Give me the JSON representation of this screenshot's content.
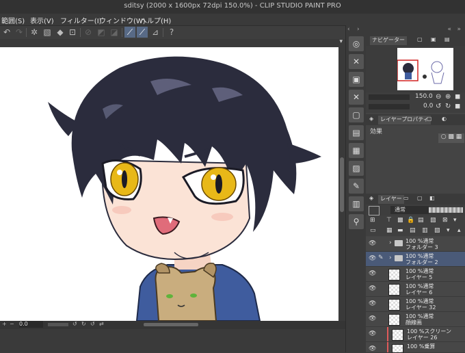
{
  "window": {
    "title": "sditsy (2000 x 1600px 72dpi 150.0%)  - CLIP STUDIO PAINT PRO"
  },
  "menu": [
    {
      "label": "範囲(S)",
      "name": "menu-selection"
    },
    {
      "label": "表示(V)",
      "name": "menu-view"
    },
    {
      "label": "フィルター(I)",
      "name": "menu-filter"
    },
    {
      "label": "ウィンドウ(W)",
      "name": "menu-window"
    },
    {
      "label": "ヘルプ(H)",
      "name": "menu-help"
    }
  ],
  "toolbar": {
    "icons": [
      "undo-icon",
      "redo-icon",
      "spinner-icon",
      "fill-icon",
      "bucket-icon",
      "transform-icon",
      "clear-icon",
      "fill-area-icon",
      "fill-outside-icon",
      "snap-ruler-icon",
      "snap-special-ruler-icon",
      "snap-grid-icon",
      "help-icon"
    ]
  },
  "navigator": {
    "tab_label": "ナビゲーター",
    "zoom": "150.0",
    "rotation": "0.0"
  },
  "layer_property": {
    "tab_label": "レイヤープロパティ",
    "effect_label": "効果"
  },
  "layers_panel": {
    "tab_label": "レイヤー",
    "blend_mode": "通常",
    "layers": [
      {
        "name": "フォルダー 3",
        "info": "100 %通常",
        "type": "folder",
        "selected": false,
        "tag": ""
      },
      {
        "name": "フォルダー 2",
        "info": "100 %通常",
        "type": "folder",
        "selected": true,
        "tag": ""
      },
      {
        "name": "レイヤー 5",
        "info": "100 %通常",
        "type": "layer",
        "selected": false,
        "tag": ""
      },
      {
        "name": "レイヤー 6",
        "info": "100 %通常",
        "type": "layer",
        "selected": false,
        "tag": ""
      },
      {
        "name": "レイヤー 32",
        "info": "100 %通常",
        "type": "layer",
        "selected": false,
        "tag": ""
      },
      {
        "name": "顔線画",
        "info": "100 %通常",
        "type": "layer",
        "selected": false,
        "tag": ""
      },
      {
        "name": "レイヤー 26",
        "info": "100 %スクリーン",
        "type": "layer",
        "selected": false,
        "tag": "#e05a5a"
      },
      {
        "name": "",
        "info": "100 %乗算",
        "type": "layer",
        "selected": false,
        "tag": "#e05a5a"
      }
    ]
  },
  "status": {
    "zoom": "0.0"
  },
  "colors": {
    "hair": "#2b2c3d",
    "hair_shine": "#6b6d8a",
    "skin": "#fbe3d6",
    "eye": "#e8b818",
    "hoodie": "#3f5c9e",
    "dog": "#c9ad7e",
    "selection": "#4a5a78"
  }
}
